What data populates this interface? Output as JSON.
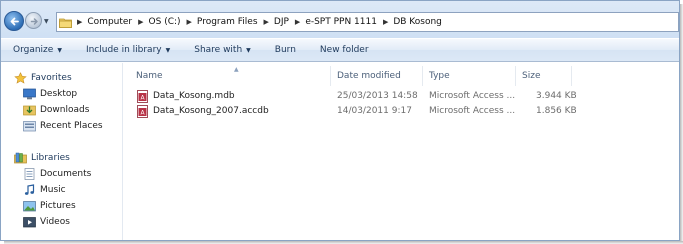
{
  "address": {
    "crumbs": [
      "Computer",
      "OS (C:)",
      "Program Files",
      "DJP",
      "e-SPT PPN 1111",
      "DB Kosong"
    ]
  },
  "toolbar": {
    "organize": "Organize",
    "include_in_library": "Include in library",
    "share_with": "Share with",
    "burn": "Burn",
    "new_folder": "New folder"
  },
  "sidebar": {
    "favorites": {
      "label": "Favorites",
      "items": [
        "Desktop",
        "Downloads",
        "Recent Places"
      ]
    },
    "libraries": {
      "label": "Libraries",
      "items": [
        "Documents",
        "Music",
        "Pictures",
        "Videos"
      ]
    }
  },
  "columns": {
    "name": "Name",
    "date_modified": "Date modified",
    "type": "Type",
    "size": "Size"
  },
  "files": [
    {
      "name": "Data_Kosong.mdb",
      "date": "25/03/2013 14:58",
      "type": "Microsoft Access ...",
      "size": "3.944 KB"
    },
    {
      "name": "Data_Kosong_2007.accdb",
      "date": "14/03/2011 9:17",
      "type": "Microsoft Access ...",
      "size": "1.856 KB"
    }
  ],
  "colors": {
    "toolbar_text": "#1e395b",
    "header_text": "#4c607a",
    "address_bg": "#dde9f7"
  }
}
